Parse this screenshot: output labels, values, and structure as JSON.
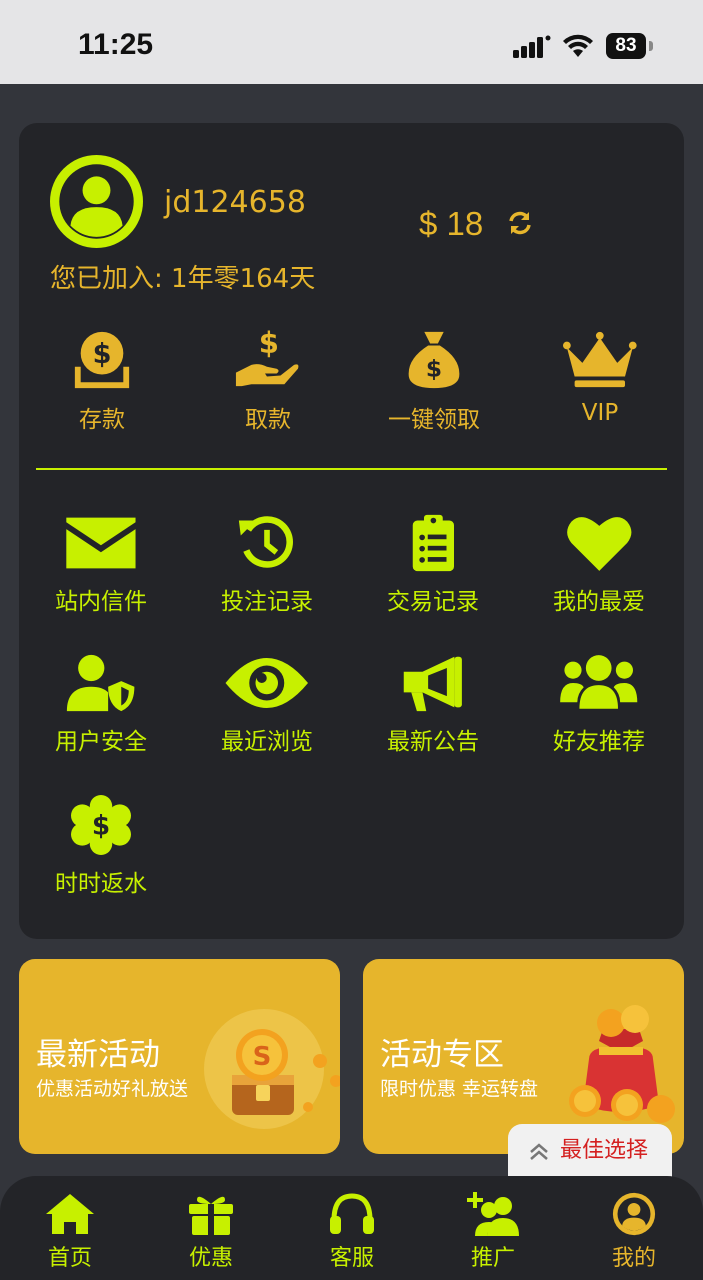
{
  "status_bar": {
    "time": "11:25",
    "battery": "83"
  },
  "profile": {
    "username": "jd124658",
    "joined": "您已加入: 1年零164天",
    "balance": "$ 18"
  },
  "quick_actions": [
    {
      "label": "存款",
      "icon": "deposit-icon"
    },
    {
      "label": "取款",
      "icon": "withdraw-icon"
    },
    {
      "label": "一键领取",
      "icon": "money-bag-icon"
    },
    {
      "label": "VIP",
      "icon": "crown-icon"
    }
  ],
  "grid": [
    {
      "label": "站内信件",
      "icon": "mail-icon"
    },
    {
      "label": "投注记录",
      "icon": "history-icon"
    },
    {
      "label": "交易记录",
      "icon": "clipboard-icon"
    },
    {
      "label": "我的最爱",
      "icon": "heart-icon"
    },
    {
      "label": "用户安全",
      "icon": "user-shield-icon"
    },
    {
      "label": "最近浏览",
      "icon": "eye-icon"
    },
    {
      "label": "最新公告",
      "icon": "megaphone-icon"
    },
    {
      "label": "好友推荐",
      "icon": "users-icon"
    },
    {
      "label": "时时返水",
      "icon": "dollar-badge-icon"
    }
  ],
  "promos": [
    {
      "title": "最新活动",
      "subtitle": "优惠活动好礼放送"
    },
    {
      "title": "活动专区",
      "subtitle": "限时优惠 幸运转盘"
    }
  ],
  "floating": {
    "label": "最佳选择"
  },
  "bottom_nav": [
    {
      "label": "首页",
      "icon": "home-icon"
    },
    {
      "label": "优惠",
      "icon": "gift-icon"
    },
    {
      "label": "客服",
      "icon": "headset-icon"
    },
    {
      "label": "推广",
      "icon": "user-plus-icon"
    },
    {
      "label": "我的",
      "icon": "user-circle-icon",
      "active": true
    }
  ],
  "colors": {
    "gold": "#e6b52c",
    "lime": "#c7f000",
    "card": "#232428",
    "background": "#33353b"
  }
}
